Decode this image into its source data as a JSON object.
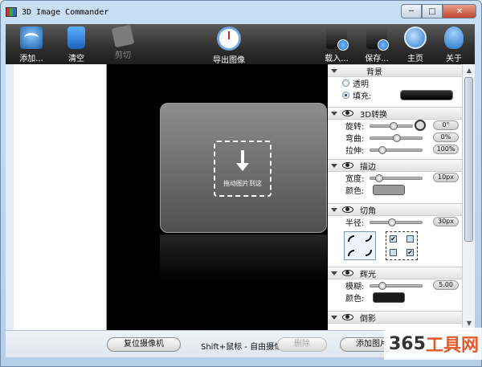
{
  "window": {
    "title": "3D Image Commander",
    "minimize": "─",
    "maximize": "□",
    "close": "✕"
  },
  "toolbar": {
    "items": [
      {
        "label": "添加...",
        "icon": "add-image-icon",
        "enabled": true
      },
      {
        "label": "清空",
        "icon": "clear-icon",
        "enabled": true
      },
      {
        "label": "剪切",
        "icon": "cut-icon",
        "enabled": false
      },
      {
        "label": "导出图像",
        "icon": "clock-export-icon",
        "enabled": true
      },
      {
        "label": "载入...",
        "icon": "load-icon",
        "enabled": true
      },
      {
        "label": "保存...",
        "icon": "save-icon",
        "enabled": true
      },
      {
        "label": "主页",
        "icon": "home-icon",
        "enabled": true
      },
      {
        "label": "关于",
        "icon": "about-icon",
        "enabled": true
      }
    ]
  },
  "viewport": {
    "drop_text": "拖动图片到这"
  },
  "panel": {
    "background": {
      "title": "背景",
      "transparent": "透明",
      "fill": "填充:",
      "selected": "fill"
    },
    "transform3d": {
      "title": "3D转换",
      "rotate_label": "旋转:",
      "rotate_value": "0°",
      "bend_label": "弯曲:",
      "bend_value": "0%",
      "stretch_label": "拉伸:",
      "stretch_value": "100%"
    },
    "stroke": {
      "title": "描边",
      "width_label": "宽度:",
      "width_value": "10px",
      "color_label": "颜色:",
      "color": "#9a9a9a"
    },
    "corner": {
      "title": "切角",
      "radius_label": "半径:",
      "radius_value": "30px"
    },
    "glow": {
      "title": "辉光",
      "blur_label": "模糊:",
      "blur_value": "5.00",
      "color_label": "颜色:",
      "color": "#1a1a1a"
    },
    "shadow": {
      "title": "倒影"
    }
  },
  "bottom": {
    "reset_camera": "复位摄像机",
    "hint": "Shift+鼠标 - 自由摄像机",
    "delete": "删除",
    "add_image": "添加图片"
  },
  "watermark": {
    "prefix": "365",
    "suffix": "工具网"
  }
}
